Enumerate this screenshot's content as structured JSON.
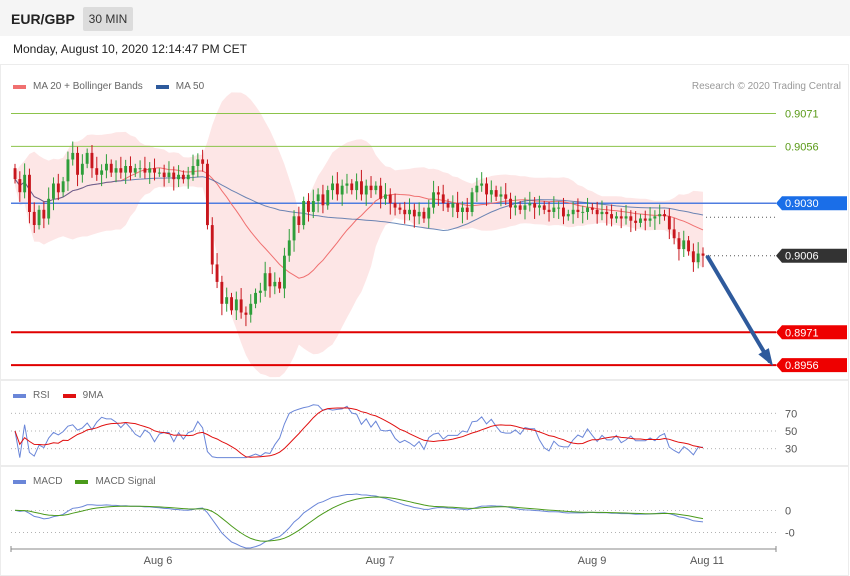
{
  "header": {
    "symbol": "EUR/GBP",
    "timeframe": "30 MIN",
    "datetime": "Monday, August 10, 2020 12:14:47 PM CET"
  },
  "legend": {
    "ma20_bb": "MA 20 + Bollinger Bands",
    "ma50": "MA 50",
    "copyright": "Research © 2020 Trading Central"
  },
  "colors": {
    "ma20": "#f07070",
    "ma50": "#2e5a9c",
    "band_fill": "#fde0e0",
    "bull": "#2e9e3a",
    "bear": "#c8161d",
    "current_line": "#4f7de0",
    "support": "#e00000",
    "resistance": "#8cc34a",
    "rsi": "#6a86d8",
    "rsi_ma": "#e01010",
    "macd": "#6a86d8",
    "macd_signal": "#4a9a1a",
    "arrow": "#2e5a9c"
  },
  "chart_data": [
    {
      "type": "candlestick",
      "name": "price",
      "x_labels": [
        "Aug 6",
        "Aug 7",
        "Aug 9",
        "Aug 11"
      ],
      "ylim": [
        0.8951,
        0.9079
      ],
      "levels": [
        {
          "value": 0.9071,
          "label": "0.9071",
          "kind": "resistance"
        },
        {
          "value": 0.9056,
          "label": "0.9056",
          "kind": "resistance"
        },
        {
          "value": 0.903,
          "label": "0.9030",
          "kind": "current"
        },
        {
          "value": 0.9006,
          "label": "0.9006",
          "kind": "last"
        },
        {
          "value": 0.8971,
          "label": "0.8971",
          "kind": "support"
        },
        {
          "value": 0.8956,
          "label": "0.8956",
          "kind": "support"
        }
      ],
      "closes": [
        0.9041,
        0.9035,
        0.9043,
        0.9026,
        0.902,
        0.9027,
        0.9023,
        0.9032,
        0.9039,
        0.9035,
        0.904,
        0.905,
        0.9053,
        0.9043,
        0.9048,
        0.9053,
        0.9046,
        0.9043,
        0.9045,
        0.9048,
        0.9044,
        0.9046,
        0.9044,
        0.9047,
        0.9044,
        0.9046,
        0.9046,
        0.9044,
        0.9046,
        0.9044,
        0.9044,
        0.9042,
        0.9044,
        0.9041,
        0.9043,
        0.9041,
        0.9043,
        0.9047,
        0.905,
        0.9048,
        0.902,
        0.9002,
        0.8994,
        0.8984,
        0.8987,
        0.8981,
        0.8986,
        0.898,
        0.8979,
        0.8984,
        0.8989,
        0.899,
        0.8998,
        0.8992,
        0.8994,
        0.8991,
        0.9006,
        0.9013,
        0.9024,
        0.902,
        0.9031,
        0.9026,
        0.9031,
        0.9034,
        0.9029,
        0.9036,
        0.9039,
        0.9034,
        0.9038,
        0.9039,
        0.9036,
        0.904,
        0.9034,
        0.9038,
        0.9036,
        0.9038,
        0.9032,
        0.9034,
        0.903,
        0.9028,
        0.9027,
        0.9025,
        0.9027,
        0.9024,
        0.9026,
        0.9023,
        0.9028,
        0.9035,
        0.9034,
        0.903,
        0.9028,
        0.903,
        0.9026,
        0.9028,
        0.9026,
        0.9035,
        0.9038,
        0.9039,
        0.9034,
        0.9036,
        0.9033,
        0.9034,
        0.9032,
        0.9028,
        0.9029,
        0.9027,
        0.9029,
        0.903,
        0.9028,
        0.9029,
        0.9027,
        0.9026,
        0.9028,
        0.9028,
        0.9024,
        0.9025,
        0.9027,
        0.9026,
        0.9026,
        0.9028,
        0.9027,
        0.9025,
        0.9026,
        0.9025,
        0.9023,
        0.9024,
        0.9023,
        0.9024,
        0.9022,
        0.9021,
        0.9023,
        0.9022,
        0.9023,
        0.9024,
        0.9025,
        0.9024,
        0.9018,
        0.9014,
        0.9009,
        0.9013,
        0.9008,
        0.9003,
        0.9007,
        0.9006
      ]
    },
    {
      "type": "line",
      "name": "RSI",
      "legend": [
        "RSI",
        "9MA"
      ],
      "y_ticks": [
        {
          "value": 70,
          "label": "70"
        },
        {
          "value": 50,
          "label": "50"
        },
        {
          "value": 30,
          "label": "30"
        }
      ],
      "ylim": [
        15,
        85
      ]
    },
    {
      "type": "line",
      "name": "MACD",
      "legend": [
        "MACD",
        "MACD Signal"
      ],
      "y_ticks": [
        {
          "value": 0,
          "label": "0"
        },
        {
          "value": -0.001,
          "label": "-0"
        }
      ],
      "ylim": [
        -0.0016,
        0.001
      ]
    }
  ]
}
